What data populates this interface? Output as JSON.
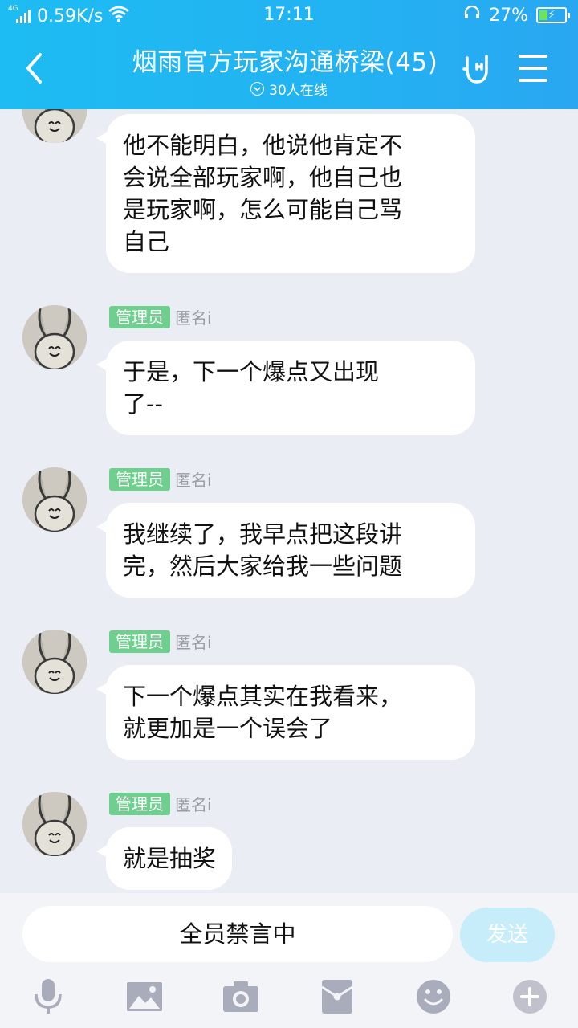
{
  "status_bar": {
    "network": "4G",
    "speed": "0.59K/s",
    "time": "17:11",
    "battery": "27%"
  },
  "header": {
    "title": "烟雨官方玩家沟通桥梁(45)",
    "online": "30人在线"
  },
  "messages": [
    {
      "text": "他不能明白，他说他肯定不\n会说全部玩家啊，他自己也\n是玩家啊，怎么可能自己骂\n自己"
    },
    {
      "role": "管理员",
      "nick": "匿名i",
      "text": "于是，下一个爆点又出现\n了--"
    },
    {
      "role": "管理员",
      "nick": "匿名i",
      "text": "我继续了，我早点把这段讲\n完，然后大家给我一些问题"
    },
    {
      "role": "管理员",
      "nick": "匿名i",
      "text": "下一个爆点其实在我看来，\n就更加是一个误会了"
    },
    {
      "role": "管理员",
      "nick": "匿名i",
      "text": "就是抽奖"
    }
  ],
  "input": {
    "text": "全员禁言中"
  },
  "send_label": "发送",
  "toolbar": [
    "microphone-icon",
    "image-icon",
    "camera-icon",
    "red-packet-icon",
    "emoji-icon",
    "plus-icon"
  ],
  "colors": {
    "header": "#1dbcf3",
    "background": "#ebedf5",
    "role_tag": "#6fcf8e",
    "send_disabled": "#c7ecfa",
    "toolbar_icon": "#a9adbb"
  }
}
